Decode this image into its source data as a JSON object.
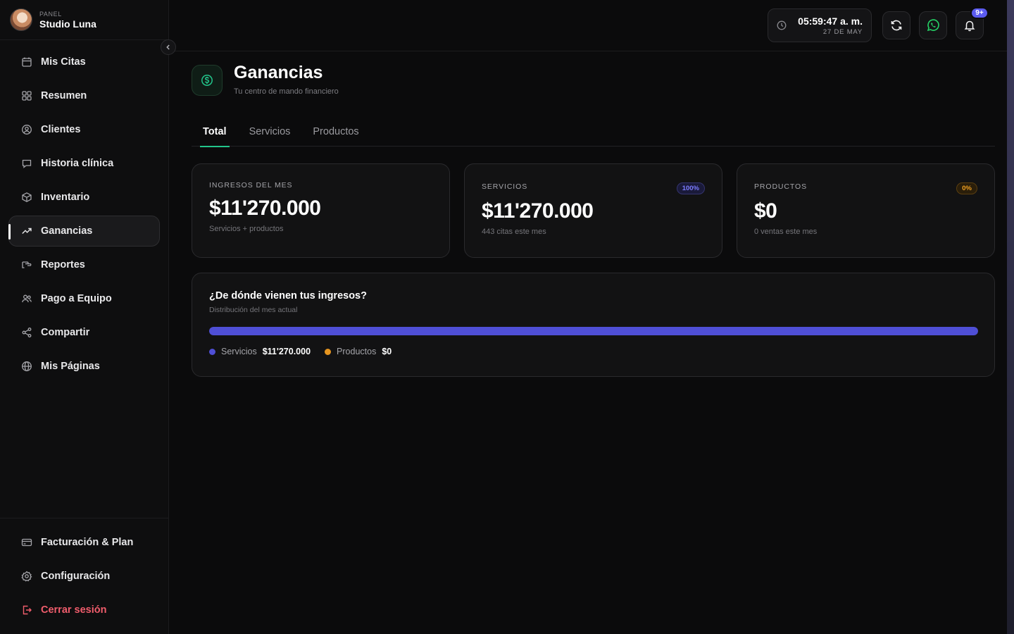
{
  "brand": {
    "kicker": "PANEL",
    "name": "Studio Luna"
  },
  "sidebar": {
    "items": [
      {
        "label": "Mis Citas",
        "icon": "calendar-icon"
      },
      {
        "label": "Resumen",
        "icon": "grid-icon"
      },
      {
        "label": "Clientes",
        "icon": "user-circle-icon"
      },
      {
        "label": "Historia clínica",
        "icon": "message-icon"
      },
      {
        "label": "Inventario",
        "icon": "box-icon"
      },
      {
        "label": "Ganancias",
        "icon": "trending-up-icon",
        "active": true
      },
      {
        "label": "Reportes",
        "icon": "hand-icon"
      },
      {
        "label": "Pago a Equipo",
        "icon": "users-icon"
      },
      {
        "label": "Compartir",
        "icon": "share-icon"
      },
      {
        "label": "Mis Páginas",
        "icon": "globe-icon"
      }
    ],
    "bottom": [
      {
        "label": "Facturación & Plan",
        "icon": "credit-card-icon"
      },
      {
        "label": "Configuración",
        "icon": "gear-icon"
      },
      {
        "label": "Cerrar sesión",
        "icon": "logout-icon"
      }
    ]
  },
  "topbar": {
    "time": "05:59:47 a. m.",
    "date": "27 DE MAY",
    "notification_badge": "9+"
  },
  "page": {
    "title": "Ganancias",
    "subtitle": "Tu centro de mando financiero"
  },
  "tabs": [
    {
      "label": "Total",
      "active": true
    },
    {
      "label": "Servicios"
    },
    {
      "label": "Productos"
    }
  ],
  "cards": {
    "ingresos": {
      "label": "INGRESOS DEL MES",
      "value": "$11'270.000",
      "note": "Servicios + productos"
    },
    "servicios": {
      "label": "SERVICIOS",
      "value": "$11'270.000",
      "note": "443 citas este mes",
      "pill": "100%"
    },
    "productos": {
      "label": "PRODUCTOS",
      "value": "$0",
      "note": "0 ventas este mes",
      "pill": "0%"
    }
  },
  "distribution": {
    "title": "¿De dónde vienen tus ingresos?",
    "subtitle": "Distribución del mes actual",
    "servicios_share": 1.0,
    "legend": [
      {
        "name": "Servicios",
        "value": "$11'270.000",
        "color": "#4f4fd6"
      },
      {
        "name": "Productos",
        "value": "$0",
        "color": "#e69520"
      }
    ]
  },
  "colors": {
    "accent_green": "#22c58b",
    "indigo": "#4f4fd6",
    "amber": "#e69520",
    "danger": "#f05d6c",
    "whatsapp": "#25d366"
  }
}
